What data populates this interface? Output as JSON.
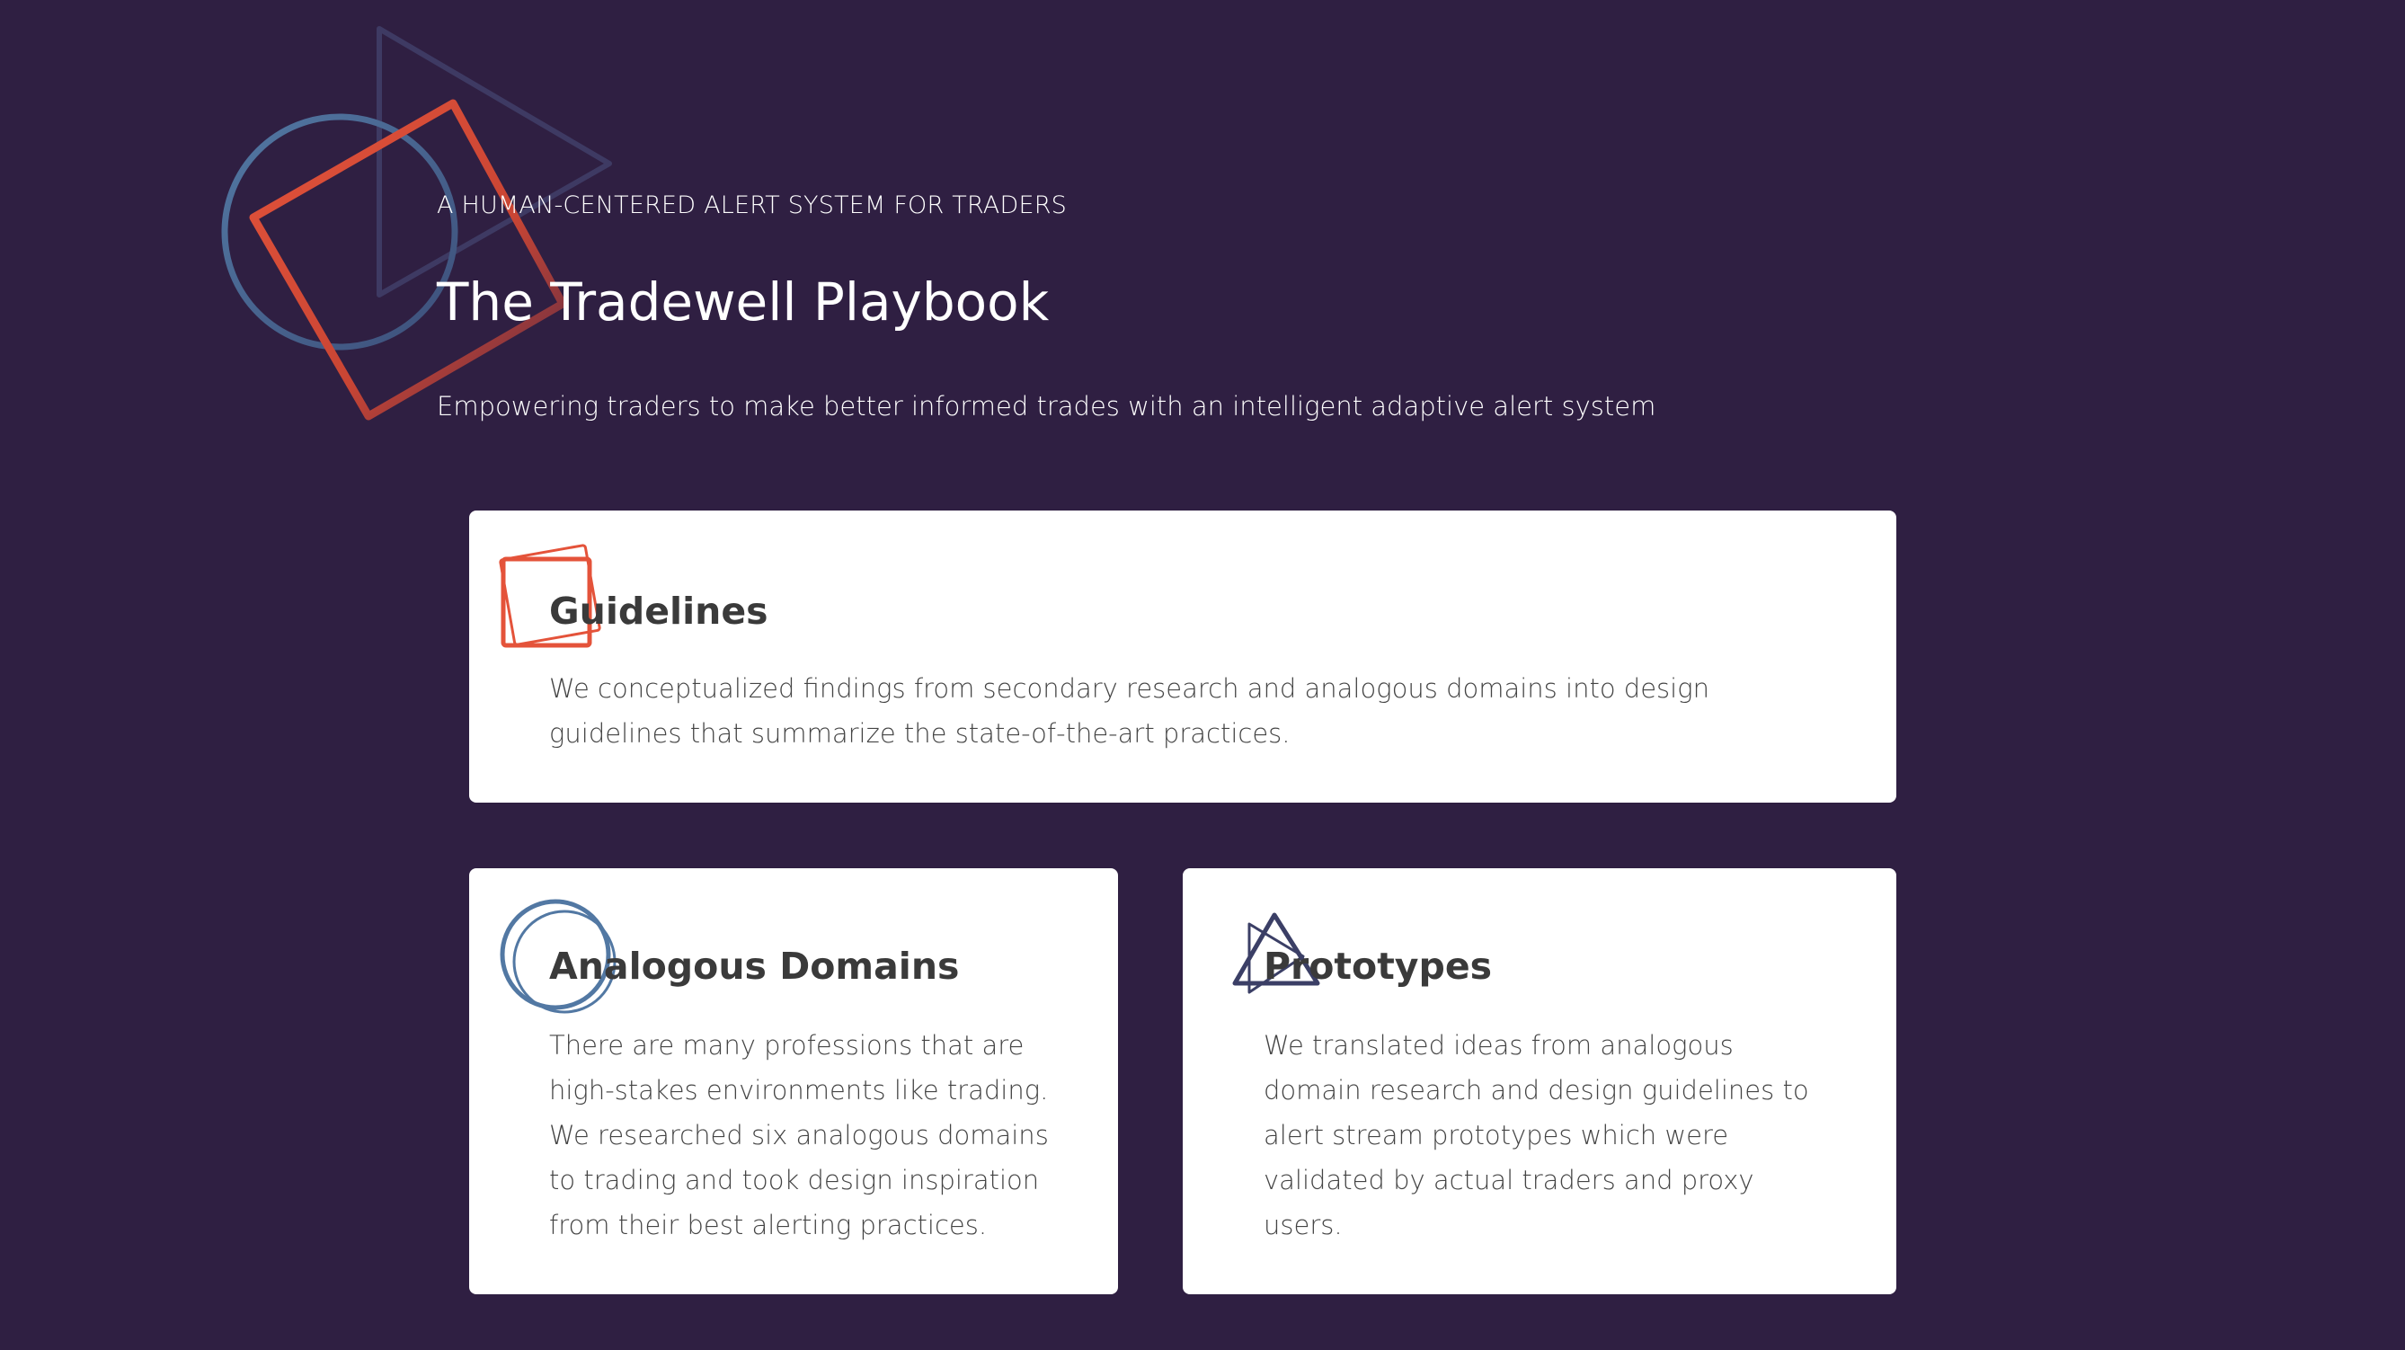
{
  "hero": {
    "eyebrow": "A HUMAN-CENTERED ALERT SYSTEM FOR TRADERS",
    "title": "The Tradewell Playbook",
    "subtitle": "Empowering traders to make better informed trades with an intelligent adaptive alert system"
  },
  "cards": {
    "guidelines": {
      "title": "Guidelines",
      "body": "We conceptualized findings from secondary research and analogous domains into design guidelines that summarize the state-of-the-art practices.",
      "icon": "overlapping-squares-icon"
    },
    "analogous": {
      "title": "Analogous Domains",
      "body": "There are many professions that are high-stakes environments like trading. We researched six analogous domains to trading and took design inspiration from their best alerting practices.",
      "icon": "overlapping-circles-icon"
    },
    "prototypes": {
      "title": "Prototypes",
      "body": "We translated ideas from analogous domain research and design guidelines to alert stream prototypes which were validated by actual traders and proxy users.",
      "icon": "overlapping-triangles-icon"
    }
  },
  "colors": {
    "background": "#2f1f42",
    "accent_orange": "#e4533a",
    "accent_blue": "#5278a3",
    "accent_navy": "#3b3f66",
    "card": "#ffffff",
    "card_text": "#444444"
  }
}
